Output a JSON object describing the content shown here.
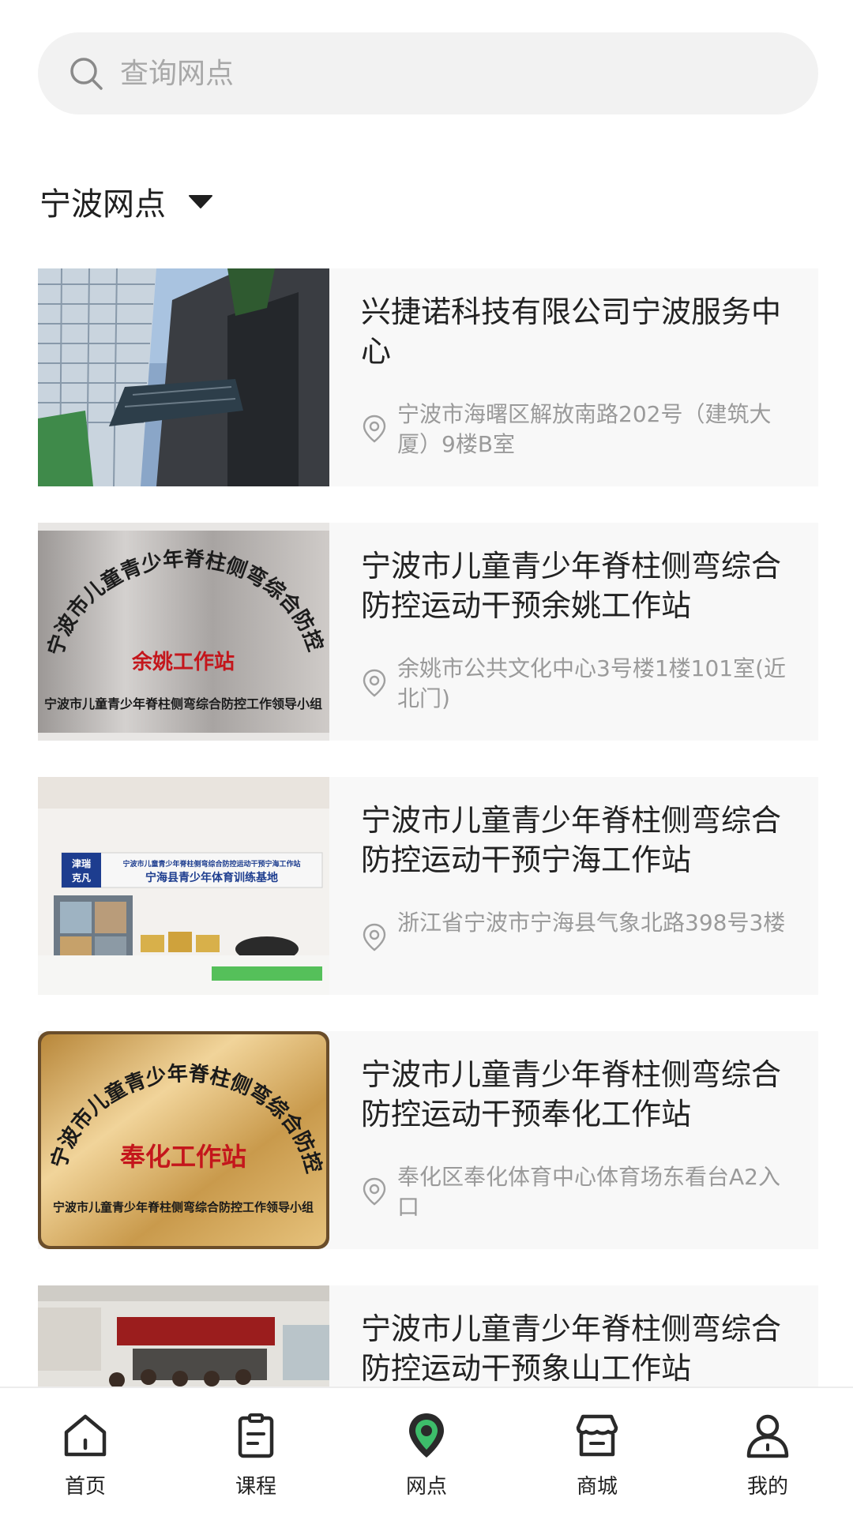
{
  "search": {
    "placeholder": "查询网点"
  },
  "region": {
    "label": "宁波网点"
  },
  "stations": [
    {
      "name": "兴捷诺科技有限公司宁波服务中心",
      "address": "宁波市海曙区解放南路202号（建筑大厦）9楼B室",
      "image": "building-photo"
    },
    {
      "name": "宁波市儿童青少年脊柱侧弯综合防控运动干预余姚工作站",
      "address": "余姚市公共文化中心3号楼1楼101室(近北门)",
      "image": "plaque-photo",
      "plaque": {
        "arc": "宁波市儿童青少年脊柱侧弯综合防控运动干预",
        "center": "余姚工作站",
        "bottom": "宁波市儿童青少年脊柱侧弯综合防控工作领导小组"
      }
    },
    {
      "name": "宁波市儿童青少年脊柱侧弯综合防控运动干预宁海工作站",
      "address": "浙江省宁波市宁海县气象北路398号3楼",
      "image": "reception-photo",
      "sign": {
        "brand_top": "津瑞",
        "brand_bottom": "克凡",
        "line1": "宁波市儿童青少年脊柱侧弯综合防控运动干预宁海工作站",
        "line2": "宁海县青少年体育训练基地"
      }
    },
    {
      "name": "宁波市儿童青少年脊柱侧弯综合防控运动干预奉化工作站",
      "address": "奉化区奉化体育中心体育场东看台A2入口",
      "image": "plaque-photo",
      "plaque": {
        "arc": "宁波市儿童青少年脊柱侧弯综合防控运动干预",
        "center": "奉化工作站",
        "bottom": "宁波市儿童青少年脊柱侧弯综合防控工作领导小组"
      }
    },
    {
      "name": "宁波市儿童青少年脊柱侧弯综合防控运动干预象山工作站",
      "address": "",
      "image": "group-photo"
    }
  ],
  "nav": {
    "items": [
      {
        "label": "首页",
        "icon": "home-icon",
        "active": false
      },
      {
        "label": "课程",
        "icon": "course-icon",
        "active": false
      },
      {
        "label": "网点",
        "icon": "location-pin-icon",
        "active": true
      },
      {
        "label": "商城",
        "icon": "store-icon",
        "active": false
      },
      {
        "label": "我的",
        "icon": "profile-icon",
        "active": false
      }
    ]
  },
  "colors": {
    "accent": "#3dbd6a",
    "text": "#222222",
    "muted": "#9a9a9a",
    "card": "#f8f8f8",
    "search_bg": "#f2f2f2"
  }
}
